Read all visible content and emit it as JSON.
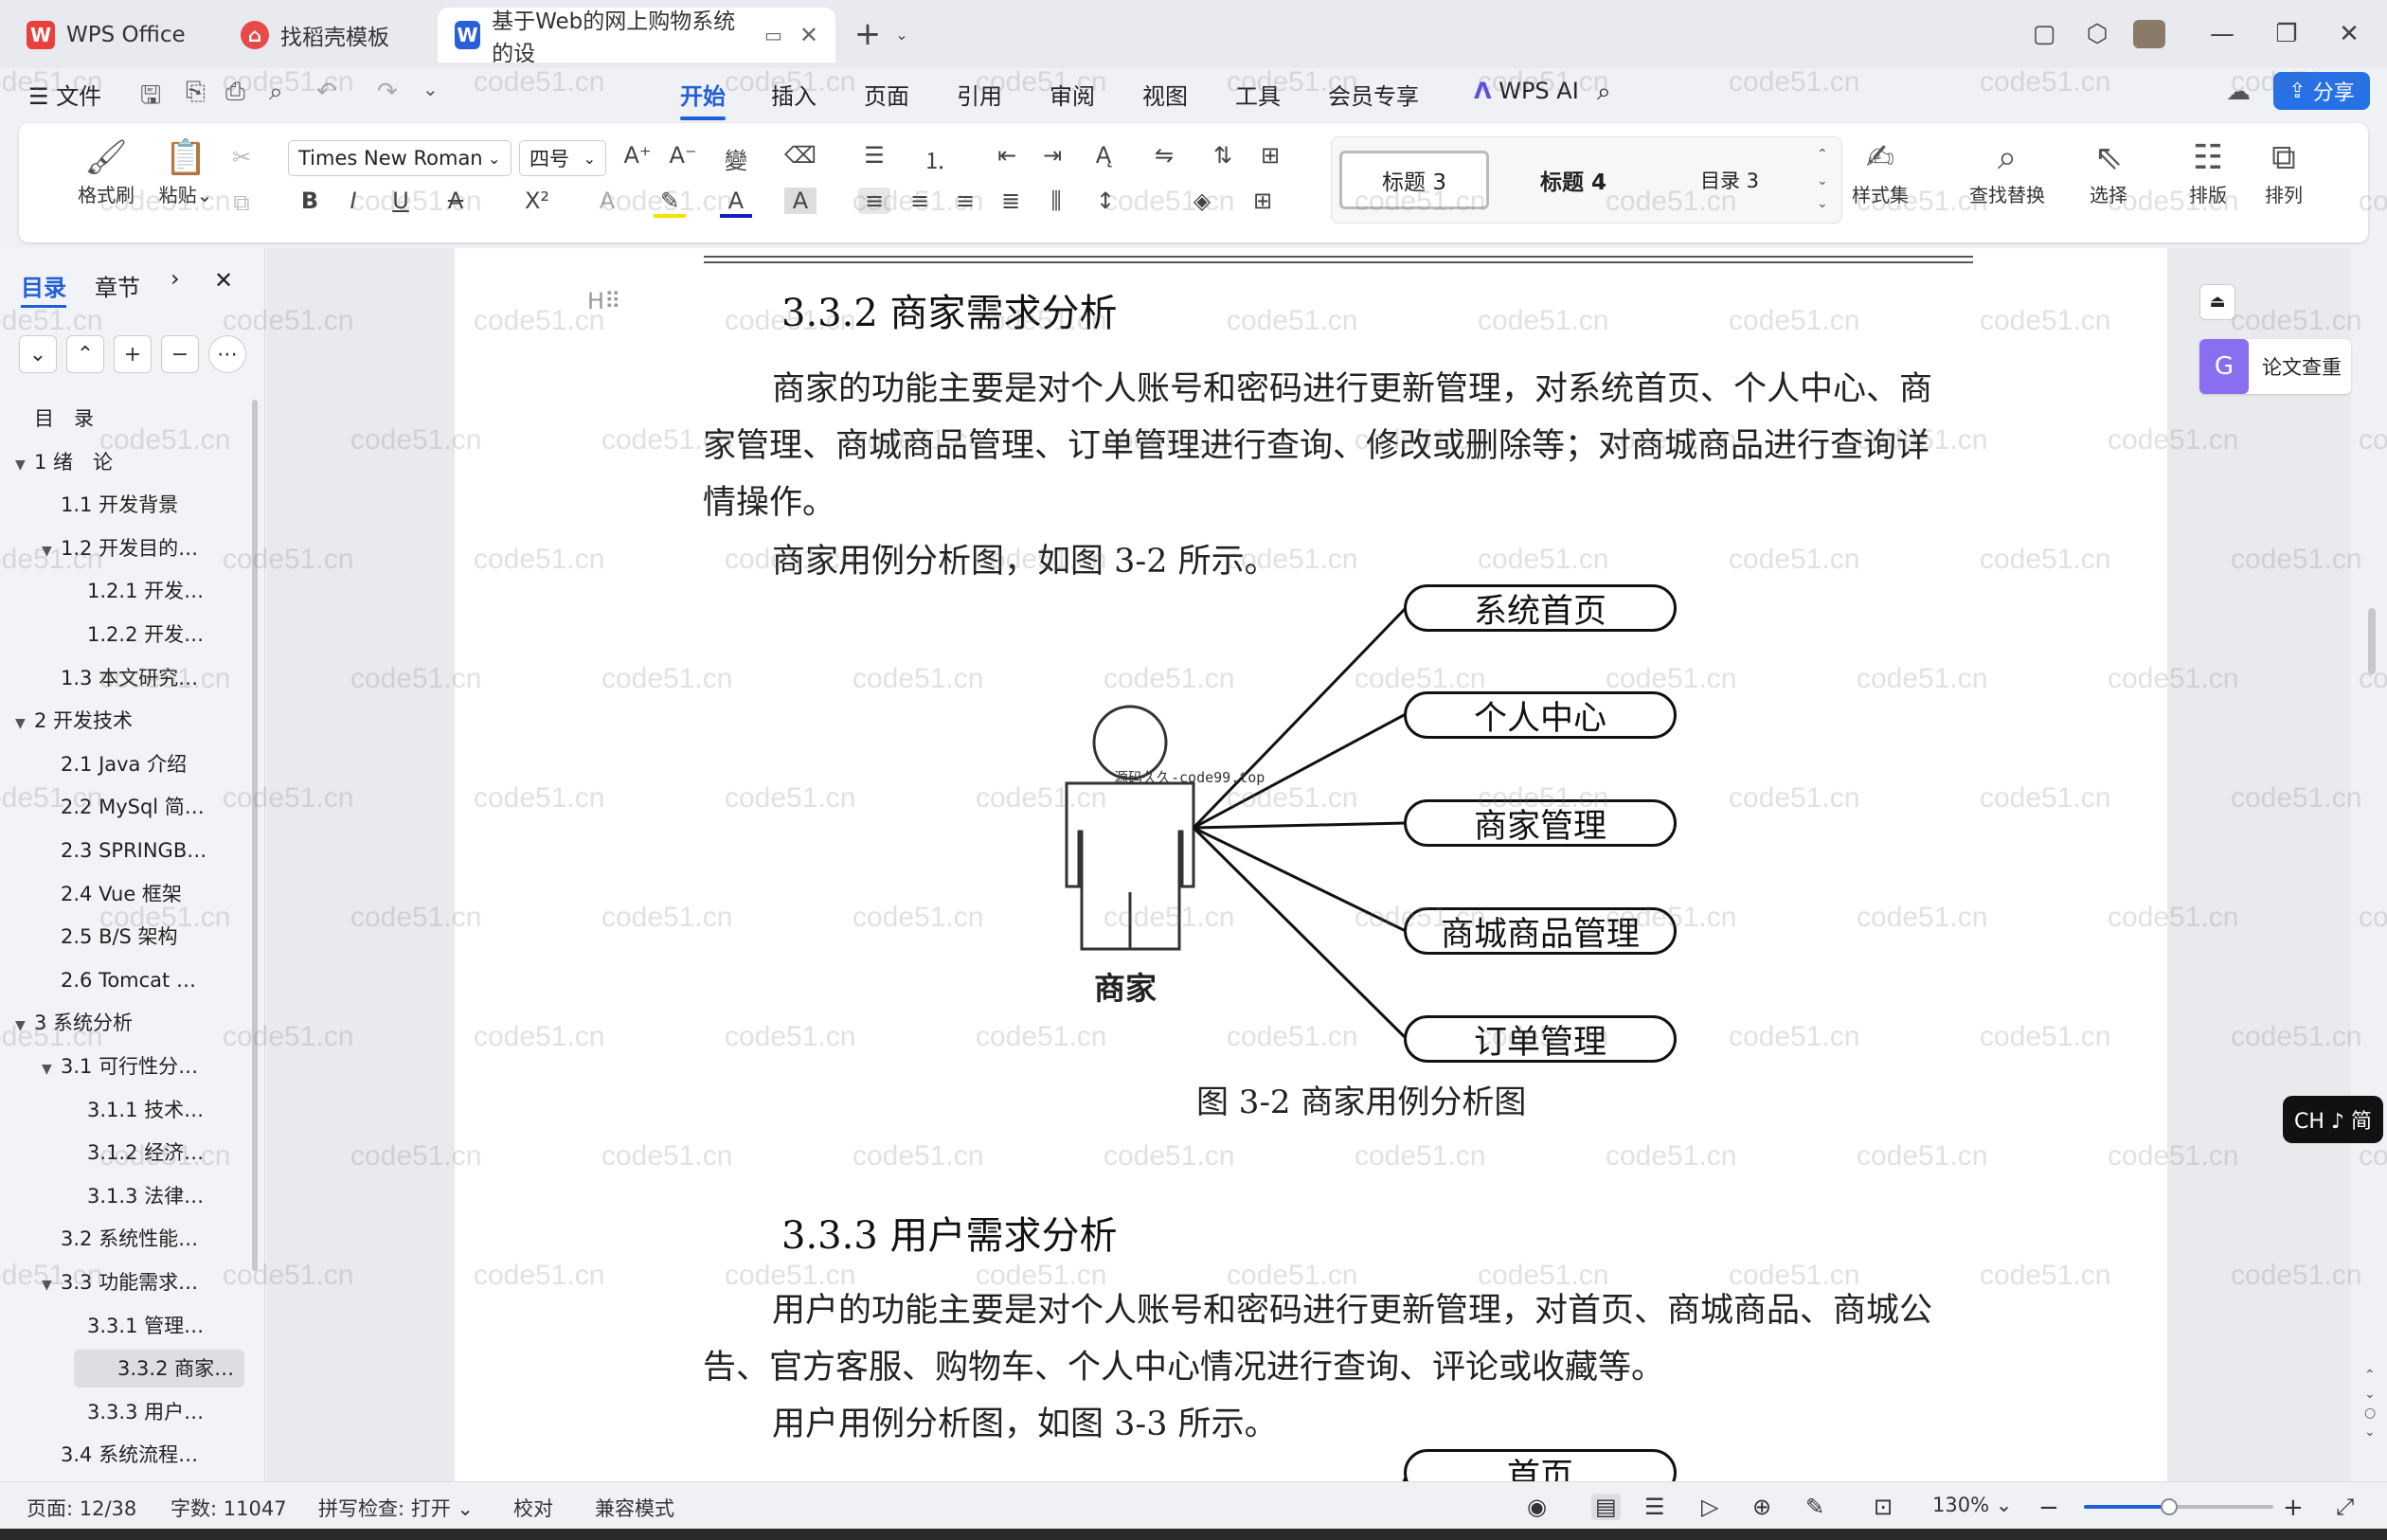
{
  "tabs": [
    {
      "label": "WPS Office",
      "icon": "wps-logo-icon"
    },
    {
      "label": "找稻壳模板",
      "icon": "daoke-icon"
    },
    {
      "label": "基于Web的网上购物系统的设",
      "icon": "word-doc-icon"
    }
  ],
  "menu": {
    "file": "文件",
    "items": [
      "开始",
      "插入",
      "页面",
      "引用",
      "审阅",
      "视图",
      "工具",
      "会员专享"
    ],
    "active": "开始",
    "wps_ai": "WPS AI",
    "share": "分享"
  },
  "ribbon": {
    "format_painter": "格式刷",
    "paste": "粘贴",
    "font_name": "Times New Roman",
    "font_size": "四号",
    "styles": [
      "标题 3",
      "标题 4",
      "目录 3"
    ],
    "style_set": "样式集",
    "find_replace": "查找替换",
    "select": "选择",
    "layout": "排版",
    "arrange": "排列"
  },
  "nav": {
    "tab_toc": "目录",
    "tab_chapter": "章节",
    "items": [
      {
        "label": "目　录",
        "level": 0,
        "toggle": ""
      },
      {
        "label": "1 绪　论",
        "level": 0,
        "toggle": "▼"
      },
      {
        "label": "1.1 开发背景",
        "level": 1,
        "toggle": ""
      },
      {
        "label": "1.2 开发目的…",
        "level": 1,
        "toggle": "▼"
      },
      {
        "label": "1.2.1 开发…",
        "level": 2,
        "toggle": ""
      },
      {
        "label": "1.2.2 开发…",
        "level": 2,
        "toggle": ""
      },
      {
        "label": "1.3 本文研究…",
        "level": 1,
        "toggle": ""
      },
      {
        "label": "2 开发技术",
        "level": 0,
        "toggle": "▼"
      },
      {
        "label": "2.1 Java 介绍",
        "level": 1,
        "toggle": ""
      },
      {
        "label": "2.2 MySql 简…",
        "level": 1,
        "toggle": ""
      },
      {
        "label": "2.3 SPRINGB…",
        "level": 1,
        "toggle": ""
      },
      {
        "label": "2.4 Vue 框架",
        "level": 1,
        "toggle": ""
      },
      {
        "label": "2.5 B/S 架构",
        "level": 1,
        "toggle": ""
      },
      {
        "label": "2.6 Tomcat …",
        "level": 1,
        "toggle": ""
      },
      {
        "label": "3 系统分析",
        "level": 0,
        "toggle": "▼"
      },
      {
        "label": "3.1 可行性分…",
        "level": 1,
        "toggle": "▼"
      },
      {
        "label": "3.1.1 技术…",
        "level": 2,
        "toggle": ""
      },
      {
        "label": "3.1.2 经济…",
        "level": 2,
        "toggle": ""
      },
      {
        "label": "3.1.3 法律…",
        "level": 2,
        "toggle": ""
      },
      {
        "label": "3.2 系统性能…",
        "level": 1,
        "toggle": ""
      },
      {
        "label": "3.3 功能需求…",
        "level": 1,
        "toggle": "▼"
      },
      {
        "label": "3.3.1 管理…",
        "level": 2,
        "toggle": ""
      },
      {
        "label": "3.3.2 商家…",
        "level": 2,
        "toggle": "",
        "selected": true
      },
      {
        "label": "3.3.3 用户…",
        "level": 2,
        "toggle": ""
      },
      {
        "label": "3.4 系统流程…",
        "level": 1,
        "toggle": ""
      }
    ]
  },
  "doc": {
    "h332": "3.3.2 商家需求分析",
    "p1_l1": "商家的功能主要是对个人账号和密码进行更新管理，对系统首页、个人中心、商",
    "p1_l2": "家管理、商城商品管理、订单管理进行查询、修改或删除等；对商城商品进行查询详",
    "p1_l3": "情操作。",
    "p2": "商家用例分析图，如图 3-2 所示。",
    "actor": "商家",
    "actor_overlay": "源码久久-code99.top",
    "usecases": [
      "系统首页",
      "个人中心",
      "商家管理",
      "商城商品管理",
      "订单管理"
    ],
    "caption": "图 3-2 商家用例分析图",
    "h333": "3.3.3 用户需求分析",
    "p3_l1": "用户的功能主要是对个人账号和密码进行更新管理，对首页、商城商品、商城公",
    "p3_l2": "告、官方客服、购物车、个人中心情况进行查询、评论或收藏等。",
    "p4": "用户用例分析图，如图 3-3 所示。",
    "next_usecase": "首页"
  },
  "right": {
    "paper_check": "论文查重",
    "ime": "CH ♪ 简"
  },
  "status": {
    "page": "页面: 12/38",
    "words": "字数: 11047",
    "spell": "拼写检查: 打开",
    "proof": "校对",
    "compat": "兼容模式",
    "zoom": "130%",
    "zoom_level": 0.45
  },
  "watermark": "code51.cn",
  "colors": {
    "accent": "#1f5fd8",
    "share": "#2670e8"
  }
}
